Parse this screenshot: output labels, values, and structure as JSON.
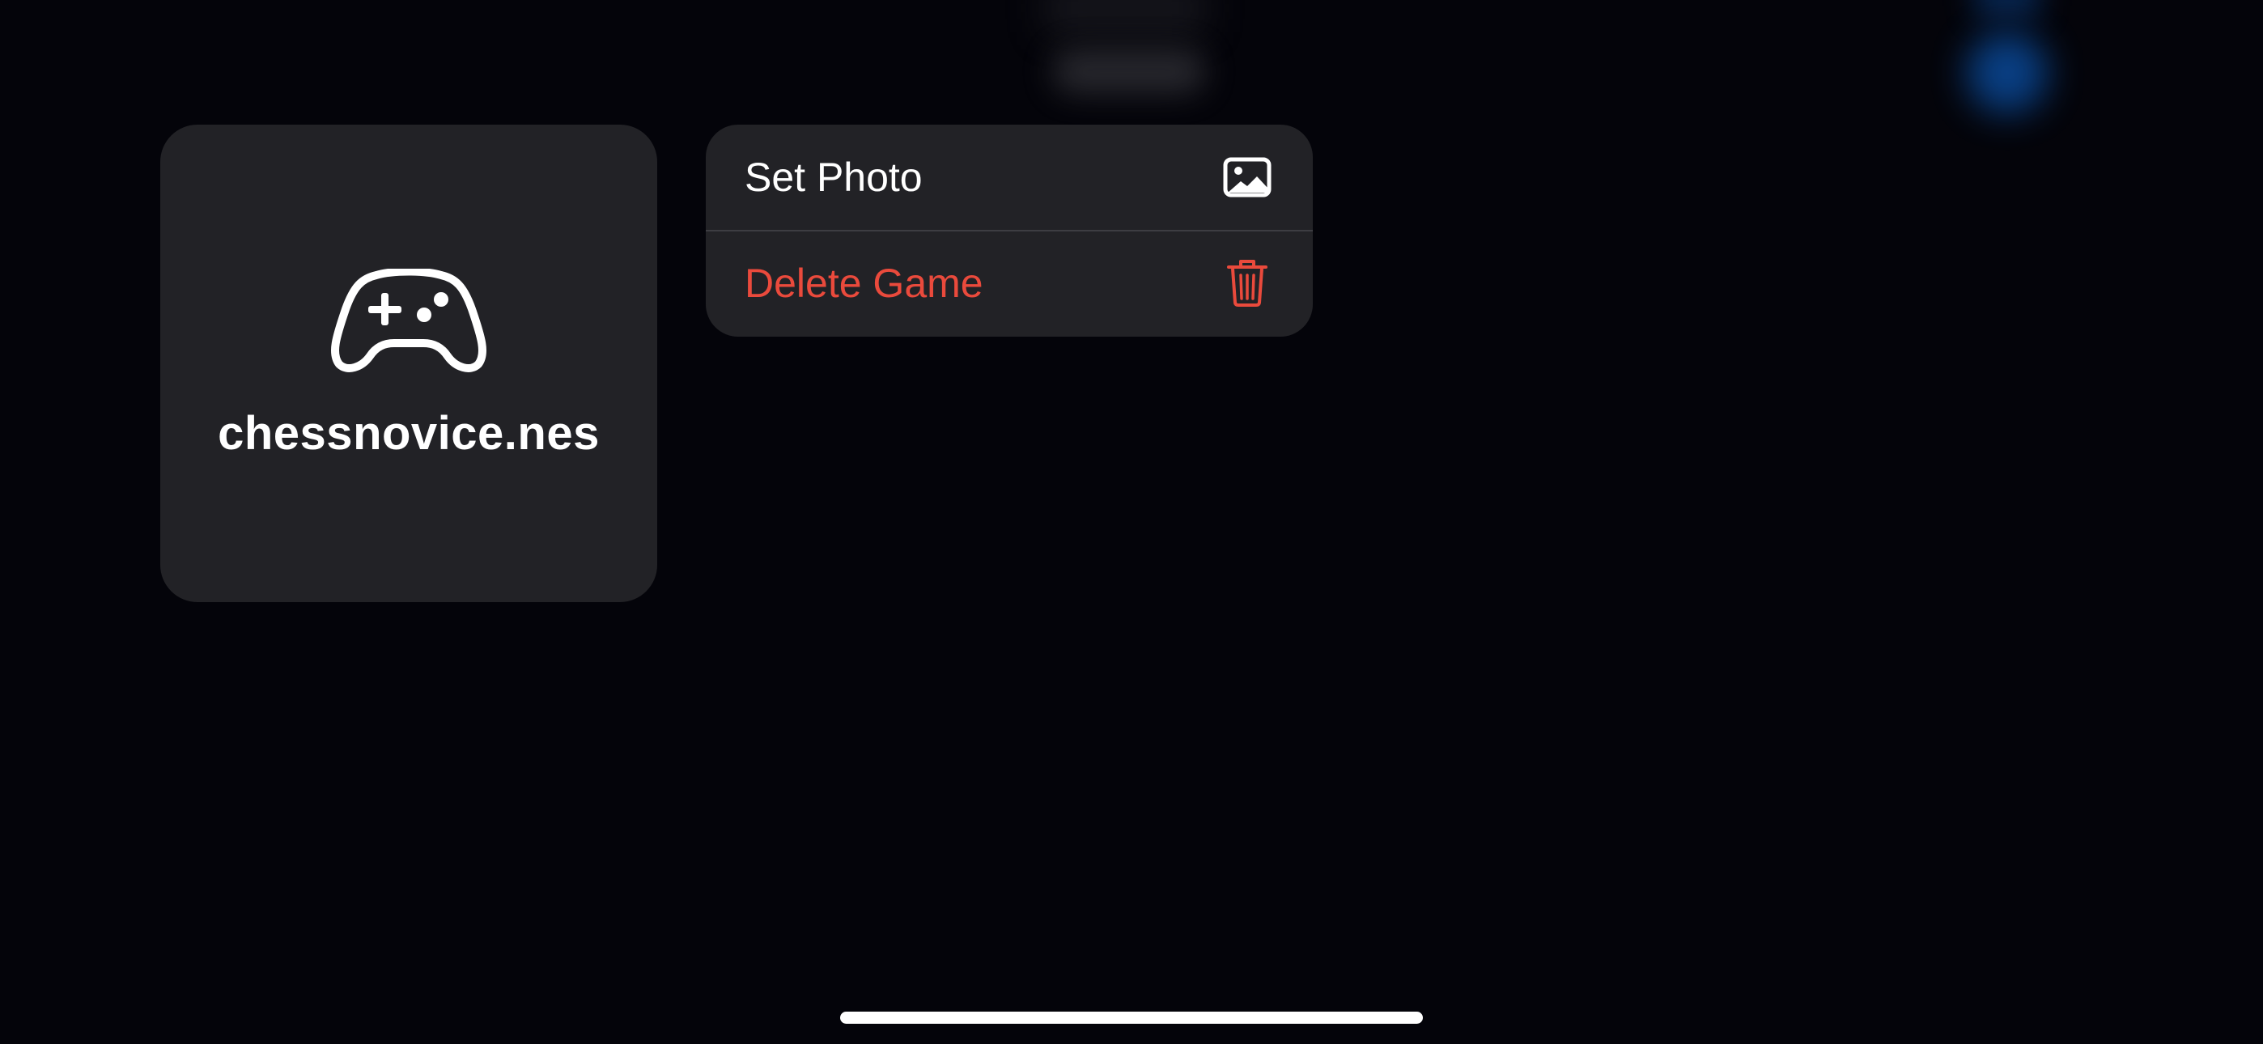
{
  "game_tile": {
    "icon": "gamecontroller-icon",
    "title": "chessnovice.nes"
  },
  "context_menu": {
    "items": [
      {
        "label": "Set Photo",
        "icon": "photo-icon",
        "destructive": false
      },
      {
        "label": "Delete Game",
        "icon": "trash-icon",
        "destructive": true
      }
    ]
  },
  "colors": {
    "background": "#04040a",
    "surface": "#222226",
    "destructive": "#ea4a3c",
    "text": "#ffffff"
  }
}
